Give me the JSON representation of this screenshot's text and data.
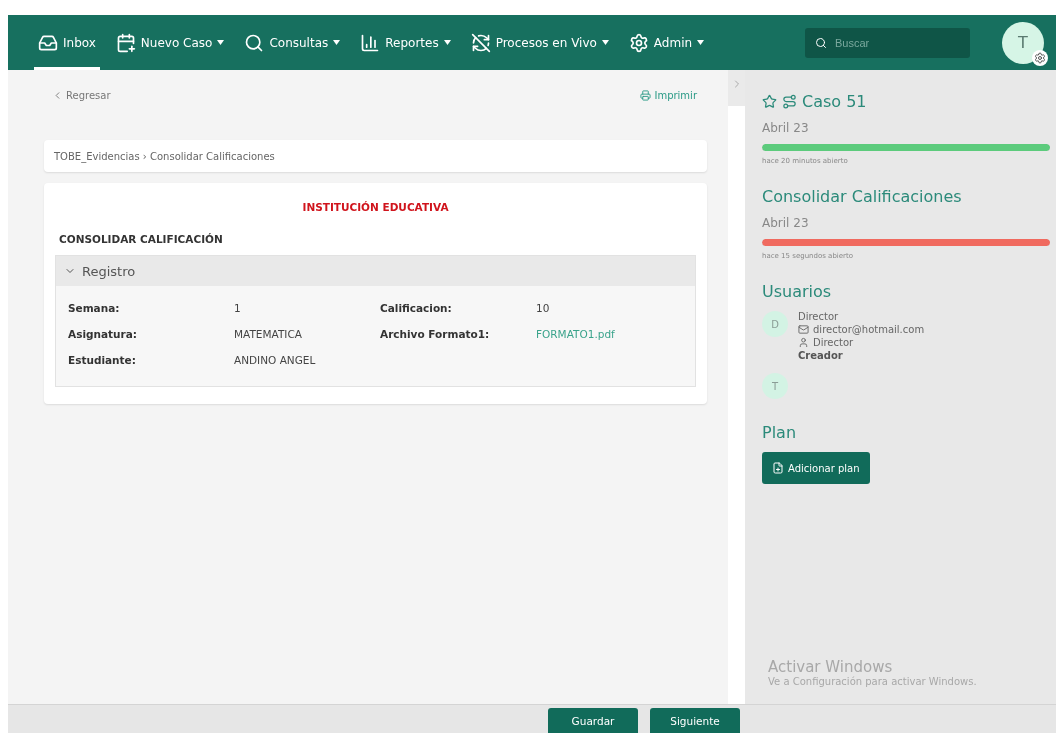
{
  "nav": {
    "items": [
      {
        "label": "Inbox",
        "dropdown": false,
        "selected": true
      },
      {
        "label": "Nuevo Caso",
        "dropdown": true,
        "selected": false
      },
      {
        "label": "Consultas",
        "dropdown": true,
        "selected": false
      },
      {
        "label": "Reportes",
        "dropdown": true,
        "selected": false
      },
      {
        "label": "Procesos en Vivo",
        "dropdown": true,
        "selected": false
      },
      {
        "label": "Admin",
        "dropdown": true,
        "selected": false
      }
    ],
    "search": {
      "placeholder": "Buscar"
    },
    "avatar": "T"
  },
  "toolbar": {
    "back": "Regresar",
    "print": "Imprimir"
  },
  "breadcrumb": "TOBE_Evidencias › Consolidar Calificaciones",
  "form": {
    "institution": "INSTITUCIÓN EDUCATIVA",
    "title": "CONSOLIDAR CALIFICACIÓN",
    "section": {
      "title": "Registro",
      "expanded": true,
      "fields": [
        {
          "label": "Semana:",
          "value": "1",
          "kind": "text"
        },
        {
          "label": "Calificacion:",
          "value": "10",
          "kind": "text"
        },
        {
          "label": "Asignatura:",
          "value": "MATEMATICA",
          "kind": "text"
        },
        {
          "label": "Archivo Formato1:",
          "value": "FORMATO1.pdf",
          "kind": "link"
        },
        {
          "label": "Estudiante:",
          "value": "ANDINO ANGEL",
          "kind": "text"
        }
      ]
    }
  },
  "panel": {
    "case": {
      "title": "Caso 51",
      "date": "Abril 23",
      "level": 1,
      "color": "#5ccb7c",
      "elapsed": "hace 20 minutos abierto"
    },
    "task": {
      "title": "Consolidar Calificaciones",
      "date": "Abril 23",
      "level": 1,
      "color": "#f06a5f",
      "elapsed": "hace 15 segundos abierto"
    },
    "users_title": "Usuarios",
    "users": [
      {
        "initial": "D",
        "name": "Director",
        "email": "director@hotmail.com",
        "role": "Director",
        "tag": "Creador"
      },
      {
        "initial": "T"
      }
    ],
    "plan_title": "Plan",
    "plan_button": "Adicionar plan"
  },
  "footer": {
    "buttons": [
      "Guardar",
      "Siguiente"
    ]
  },
  "os_notice": {
    "title": "Activar Windows",
    "text": "Ve a Configuración para activar Windows."
  }
}
